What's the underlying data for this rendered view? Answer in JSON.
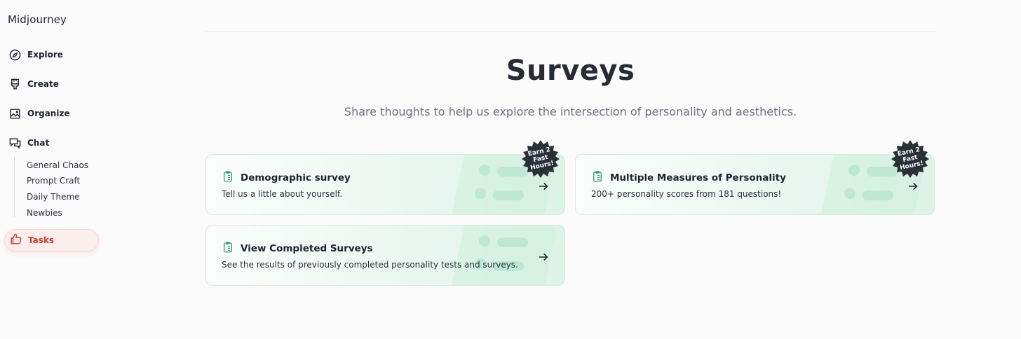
{
  "brand": "Midjourney",
  "nav": {
    "explore": "Explore",
    "create": "Create",
    "organize": "Organize",
    "chat": "Chat",
    "channels": [
      "General Chaos",
      "Prompt Craft",
      "Daily Theme",
      "Newbies"
    ],
    "tasks": "Tasks"
  },
  "page": {
    "title": "Surveys",
    "subtitle": "Share thoughts to help us explore the intersection of personality and aesthetics."
  },
  "cards": [
    {
      "title": "Demographic survey",
      "desc": "Tell us a little about yourself.",
      "badge": "Earn 2 Fast Hours!"
    },
    {
      "title": "Multiple Measures of Personality",
      "desc": "200+ personality scores from 181 questions!",
      "badge": "Earn 2 Fast Hours!"
    },
    {
      "title": "View Completed Surveys",
      "desc": "See the results of previously completed personality tests and surveys."
    }
  ],
  "colors": {
    "accent_green": "#2f9e6e",
    "tasks_red": "#d43b2f",
    "badge_dark": "#2b2f38"
  },
  "icons": {
    "explore": "compass-icon",
    "create": "brush-icon",
    "organize": "image-icon",
    "chat": "chat-bubbles-icon",
    "tasks": "thumbs-up-icon",
    "card": "clipboard-list-icon",
    "arrow": "arrow-right-icon"
  }
}
